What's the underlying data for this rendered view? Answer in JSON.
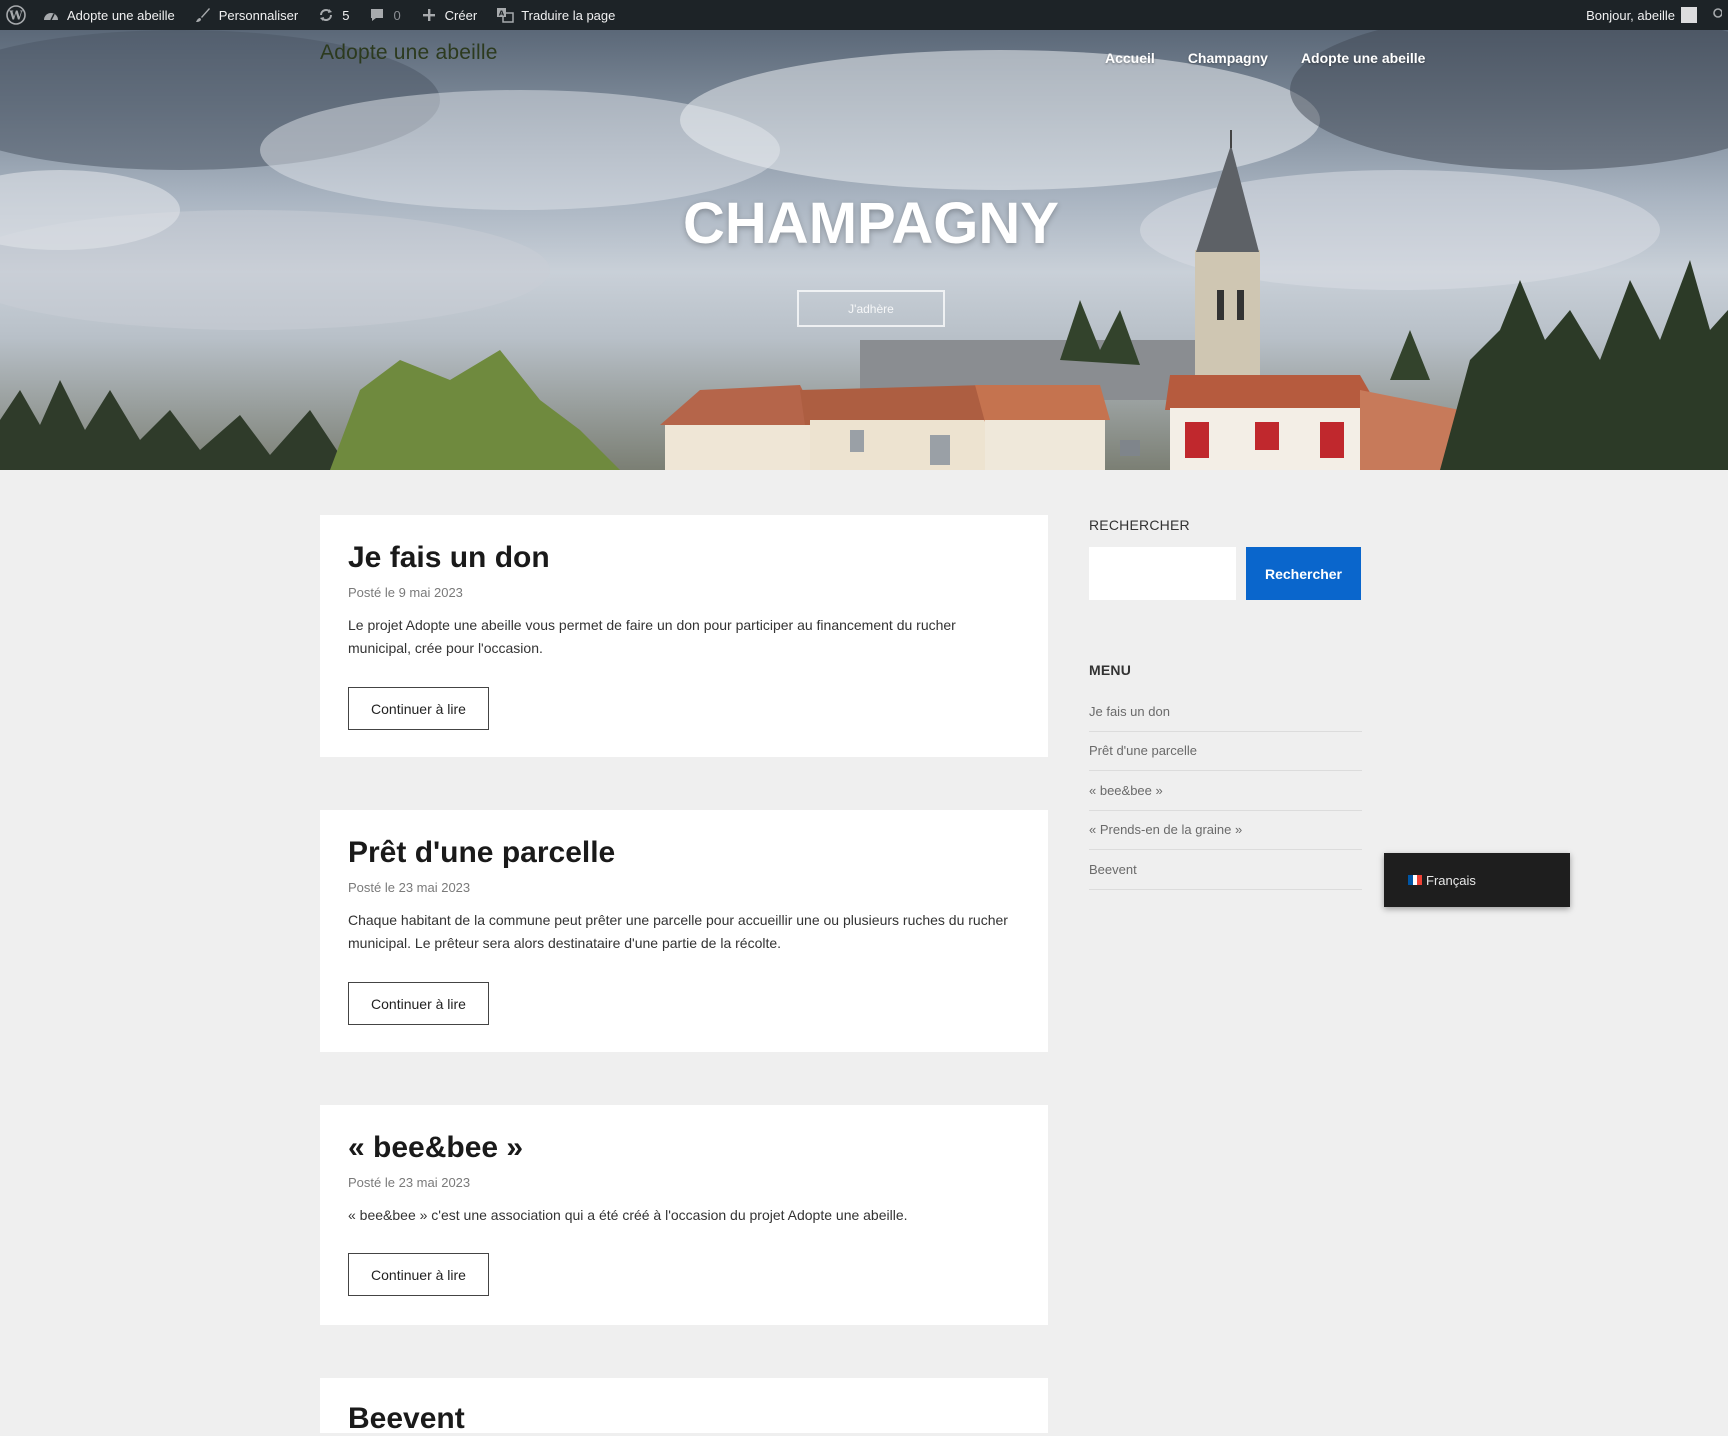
{
  "adminbar": {
    "site_name": "Adopte une abeille",
    "customize": "Personnaliser",
    "updates_count": "5",
    "comments_count": "0",
    "create": "Créer",
    "translate": "Traduire la page",
    "greeting": "Bonjour, abeille"
  },
  "header": {
    "site_title": "Adopte une abeille",
    "nav": [
      "Accueil",
      "Champagny",
      "Adopte une abeille"
    ]
  },
  "hero": {
    "title": "CHAMPAGNY",
    "button_label": "J'adhère"
  },
  "posts": [
    {
      "title": "Je fais un don",
      "meta": "Posté le 9 mai 2023",
      "excerpt": "Le projet Adopte une abeille vous permet de faire un don pour participer au financement du rucher municipal, crée pour l'occasion.",
      "more": "Continuer à lire"
    },
    {
      "title": "Prêt d'une parcelle",
      "meta": "Posté le 23 mai 2023",
      "excerpt": "Chaque habitant de la commune peut prêter une parcelle pour accueillir une ou plusieurs ruches du rucher municipal. Le prêteur sera alors destinataire d'une partie de la récolte.",
      "more": "Continuer à lire"
    },
    {
      "title": "« bee&bee »",
      "meta": "Posté le 23 mai 2023",
      "excerpt": "« bee&bee » c'est une association qui a été créé à l'occasion du projet Adopte une abeille.",
      "more": "Continuer à lire"
    },
    {
      "title": "Beevent"
    }
  ],
  "sidebar": {
    "search_title": "RECHERCHER",
    "search_button": "Rechercher",
    "menu_title": "MENU",
    "menu_items": [
      "Je fais un don",
      "Prêt d'une parcelle",
      "« bee&bee »",
      "« Prends-en de la graine »",
      "Beevent"
    ]
  },
  "language_switcher": {
    "label": "Français"
  },
  "colors": {
    "adminbar_bg": "#1d2327",
    "accent": "#0a66cc",
    "page_bg": "#efefef"
  }
}
